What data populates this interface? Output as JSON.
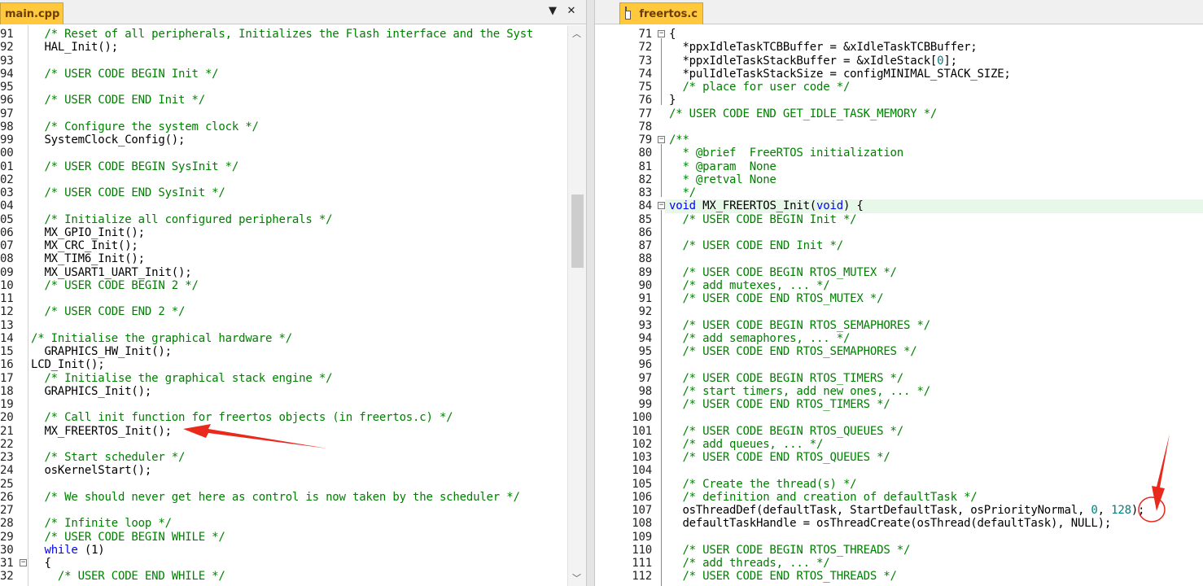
{
  "left": {
    "tab_label": "main.cpp",
    "menu_icon": "▼",
    "close_icon": "✕",
    "lines": [
      {
        "n": "91",
        "t": "  /* Reset of all peripherals, Initializes the Flash interface and the Syst",
        "c": "cm"
      },
      {
        "n": "92",
        "t": "  HAL_Init();",
        "c": ""
      },
      {
        "n": "93",
        "t": "",
        "c": ""
      },
      {
        "n": "94",
        "t": "  /* USER CODE BEGIN Init */",
        "c": "cm"
      },
      {
        "n": "95",
        "t": "",
        "c": ""
      },
      {
        "n": "96",
        "t": "  /* USER CODE END Init */",
        "c": "cm"
      },
      {
        "n": "97",
        "t": "",
        "c": ""
      },
      {
        "n": "98",
        "t": "  /* Configure the system clock */",
        "c": "cm"
      },
      {
        "n": "99",
        "t": "  SystemClock_Config();",
        "c": ""
      },
      {
        "n": "00",
        "t": "",
        "c": ""
      },
      {
        "n": "01",
        "t": "  /* USER CODE BEGIN SysInit */",
        "c": "cm"
      },
      {
        "n": "02",
        "t": "",
        "c": ""
      },
      {
        "n": "03",
        "t": "  /* USER CODE END SysInit */",
        "c": "cm"
      },
      {
        "n": "04",
        "t": "",
        "c": ""
      },
      {
        "n": "05",
        "t": "  /* Initialize all configured peripherals */",
        "c": "cm"
      },
      {
        "n": "06",
        "t": "  MX_GPIO_Init();",
        "c": ""
      },
      {
        "n": "07",
        "t": "  MX_CRC_Init();",
        "c": ""
      },
      {
        "n": "08",
        "t": "  MX_TIM6_Init();",
        "c": ""
      },
      {
        "n": "09",
        "t": "  MX_USART1_UART_Init();",
        "c": ""
      },
      {
        "n": "10",
        "t": "  /* USER CODE BEGIN 2 */",
        "c": "cm"
      },
      {
        "n": "11",
        "t": "",
        "c": ""
      },
      {
        "n": "12",
        "t": "  /* USER CODE END 2 */",
        "c": "cm"
      },
      {
        "n": "13",
        "t": "",
        "c": ""
      },
      {
        "n": "14",
        "t": "/* Initialise the graphical hardware */",
        "c": "cm"
      },
      {
        "n": "15",
        "t": "  GRAPHICS_HW_Init();",
        "c": ""
      },
      {
        "n": "16",
        "t": "LCD_Init();",
        "c": ""
      },
      {
        "n": "17",
        "t": "  /* Initialise the graphical stack engine */",
        "c": "cm"
      },
      {
        "n": "18",
        "t": "  GRAPHICS_Init();",
        "c": ""
      },
      {
        "n": "19",
        "t": "",
        "c": ""
      },
      {
        "n": "20",
        "t": "  /* Call init function for freertos objects (in freertos.c) */",
        "c": "cm"
      },
      {
        "n": "21",
        "t": "  MX_FREERTOS_Init();",
        "c": ""
      },
      {
        "n": "22",
        "t": "",
        "c": ""
      },
      {
        "n": "23",
        "t": "  /* Start scheduler */",
        "c": "cm"
      },
      {
        "n": "24",
        "t": "  osKernelStart();",
        "c": ""
      },
      {
        "n": "25",
        "t": "",
        "c": ""
      },
      {
        "n": "26",
        "t": "  /* We should never get here as control is now taken by the scheduler */",
        "c": "cm"
      },
      {
        "n": "27",
        "t": "",
        "c": ""
      },
      {
        "n": "28",
        "t": "  /* Infinite loop */",
        "c": "cm"
      },
      {
        "n": "29",
        "t": "  /* USER CODE BEGIN WHILE */",
        "c": "cm"
      },
      {
        "n": "30",
        "t": "  while (1)",
        "c": "while"
      },
      {
        "n": "31",
        "t": "  {",
        "c": ""
      },
      {
        "n": "32",
        "t": "    /* USER CODE END WHILE */",
        "c": "cm"
      }
    ]
  },
  "right": {
    "tab_label": "freertos.c",
    "lines": [
      {
        "n": "71",
        "t": "{",
        "c": ""
      },
      {
        "n": "72",
        "t": "  *ppxIdleTaskTCBBuffer = &xIdleTaskTCBBuffer;",
        "c": ""
      },
      {
        "n": "73",
        "t": "  *ppxIdleTaskStackBuffer = &xIdleStack[0];",
        "c": "stack"
      },
      {
        "n": "74",
        "t": "  *pulIdleTaskStackSize = configMINIMAL_STACK_SIZE;",
        "c": ""
      },
      {
        "n": "75",
        "t": "  /* place for user code */",
        "c": "cm"
      },
      {
        "n": "76",
        "t": "}",
        "c": ""
      },
      {
        "n": "77",
        "t": "/* USER CODE END GET_IDLE_TASK_MEMORY */",
        "c": "cm"
      },
      {
        "n": "78",
        "t": "",
        "c": ""
      },
      {
        "n": "79",
        "t": "/**",
        "c": "cm"
      },
      {
        "n": "80",
        "t": "  * @brief  FreeRTOS initialization",
        "c": "cm"
      },
      {
        "n": "81",
        "t": "  * @param  None",
        "c": "cm"
      },
      {
        "n": "82",
        "t": "  * @retval None",
        "c": "cm"
      },
      {
        "n": "83",
        "t": "  */",
        "c": "cm"
      },
      {
        "n": "84",
        "t": "void MX_FREERTOS_Init(void) {",
        "c": "void"
      },
      {
        "n": "85",
        "t": "  /* USER CODE BEGIN Init */",
        "c": "cm"
      },
      {
        "n": "86",
        "t": "",
        "c": ""
      },
      {
        "n": "87",
        "t": "  /* USER CODE END Init */",
        "c": "cm"
      },
      {
        "n": "88",
        "t": "",
        "c": ""
      },
      {
        "n": "89",
        "t": "  /* USER CODE BEGIN RTOS_MUTEX */",
        "c": "cm"
      },
      {
        "n": "90",
        "t": "  /* add mutexes, ... */",
        "c": "cm"
      },
      {
        "n": "91",
        "t": "  /* USER CODE END RTOS_MUTEX */",
        "c": "cm"
      },
      {
        "n": "92",
        "t": "",
        "c": ""
      },
      {
        "n": "93",
        "t": "  /* USER CODE BEGIN RTOS_SEMAPHORES */",
        "c": "cm"
      },
      {
        "n": "94",
        "t": "  /* add semaphores, ... */",
        "c": "cm"
      },
      {
        "n": "95",
        "t": "  /* USER CODE END RTOS_SEMAPHORES */",
        "c": "cm"
      },
      {
        "n": "96",
        "t": "",
        "c": ""
      },
      {
        "n": "97",
        "t": "  /* USER CODE BEGIN RTOS_TIMERS */",
        "c": "cm"
      },
      {
        "n": "98",
        "t": "  /* start timers, add new ones, ... */",
        "c": "cm"
      },
      {
        "n": "99",
        "t": "  /* USER CODE END RTOS_TIMERS */",
        "c": "cm"
      },
      {
        "n": "100",
        "t": "",
        "c": ""
      },
      {
        "n": "101",
        "t": "  /* USER CODE BEGIN RTOS_QUEUES */",
        "c": "cm"
      },
      {
        "n": "102",
        "t": "  /* add queues, ... */",
        "c": "cm"
      },
      {
        "n": "103",
        "t": "  /* USER CODE END RTOS_QUEUES */",
        "c": "cm"
      },
      {
        "n": "104",
        "t": "",
        "c": ""
      },
      {
        "n": "105",
        "t": "  /* Create the thread(s) */",
        "c": "cm"
      },
      {
        "n": "106",
        "t": "  /* definition and creation of defaultTask */",
        "c": "cm"
      },
      {
        "n": "107",
        "t": "  osThreadDef(defaultTask, StartDefaultTask, osPriorityNormal, 0, 128);",
        "c": "thread"
      },
      {
        "n": "108",
        "t": "  defaultTaskHandle = osThreadCreate(osThread(defaultTask), NULL);",
        "c": ""
      },
      {
        "n": "109",
        "t": "",
        "c": ""
      },
      {
        "n": "110",
        "t": "  /* USER CODE BEGIN RTOS_THREADS */",
        "c": "cm"
      },
      {
        "n": "111",
        "t": "  /* add threads, ... */",
        "c": "cm"
      },
      {
        "n": "112",
        "t": "  /* USER CODE END RTOS_THREADS */",
        "c": "cm"
      }
    ]
  },
  "annotations": {
    "arrow_color": "#e8291c"
  }
}
